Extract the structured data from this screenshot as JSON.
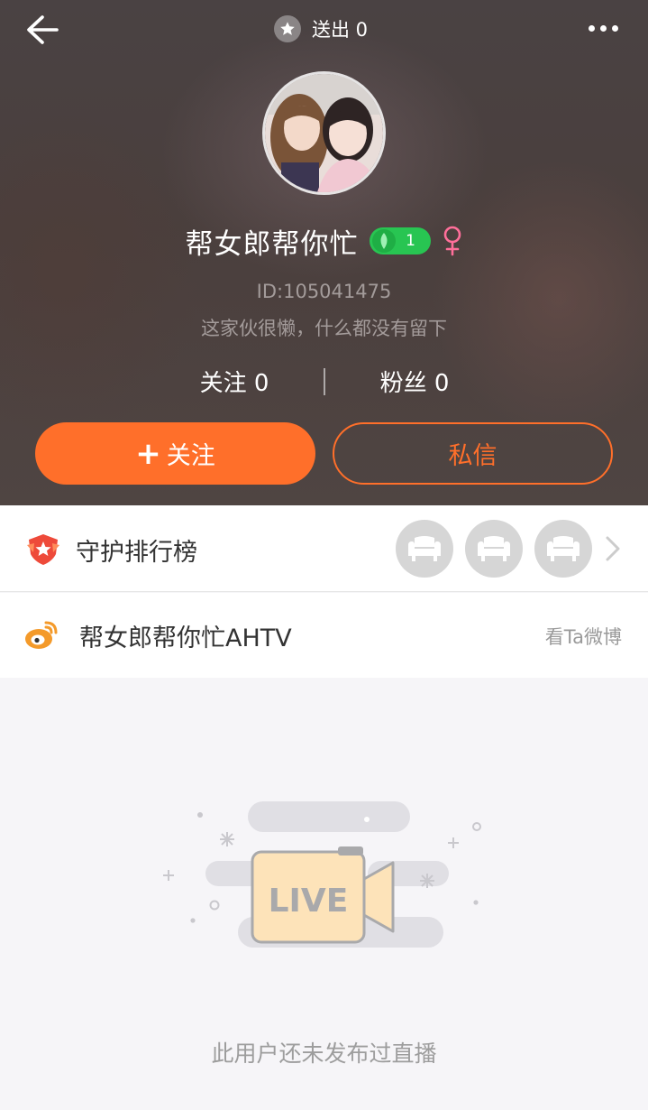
{
  "header": {
    "sent_label": "送出 0",
    "name": "帮女郎帮你忙",
    "level": "1",
    "user_id": "ID:105041475",
    "bio": "这家伙很懒，什么都没有留下",
    "following": "关注 0",
    "fans": "粉丝 0",
    "follow_button": "关注",
    "message_button": "私信"
  },
  "guard": {
    "label": "守护排行榜"
  },
  "weibo": {
    "name": "帮女郎帮你忙AHTV",
    "link": "看Ta微博"
  },
  "empty_state": {
    "badge_text": "LIVE",
    "message": "此用户还未发布过直播"
  },
  "colors": {
    "accent": "#ff6f2a",
    "level_green": "#28c552",
    "gender_pink": "#ff6f9a"
  }
}
